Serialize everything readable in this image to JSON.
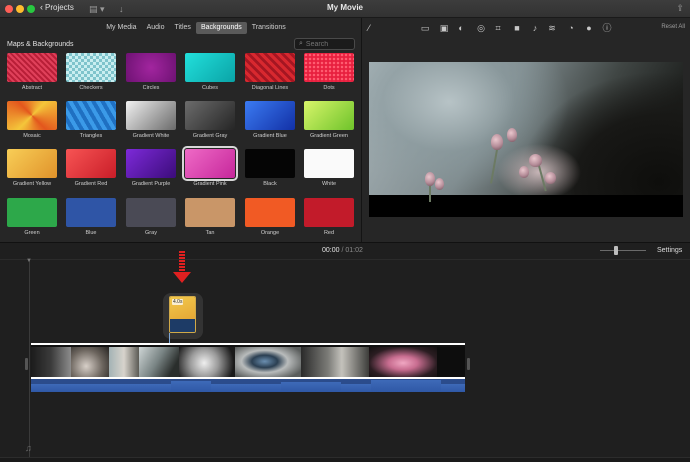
{
  "window": {
    "title": "My Movie",
    "projects_label": "Projects",
    "icons": [
      "close-icon",
      "minimize-icon",
      "zoom-icon",
      "chevron-left-icon",
      "library-list-icon",
      "import-icon",
      "share-icon"
    ]
  },
  "library": {
    "tabs": [
      {
        "label": "My Media",
        "active": false
      },
      {
        "label": "Audio",
        "active": false
      },
      {
        "label": "Titles",
        "active": false
      },
      {
        "label": "Backgrounds",
        "active": true
      },
      {
        "label": "Transitions",
        "active": false
      }
    ],
    "section_title": "Maps & Backgrounds",
    "search": {
      "placeholder": "Search",
      "value": ""
    },
    "backgrounds": [
      {
        "label": "Abstract",
        "color": "#d9344b"
      },
      {
        "label": "Checkers",
        "color": "#8fd0d4"
      },
      {
        "label": "Circles",
        "color": "#8a1b8e"
      },
      {
        "label": "Cubes",
        "color": "#14c7c4"
      },
      {
        "label": "Diagonal Lines",
        "color": "#c4202c"
      },
      {
        "label": "Dots",
        "color": "#e8203f"
      },
      {
        "label": "Mosaic",
        "color": "#f2a21c"
      },
      {
        "label": "Triangles",
        "color": "#2a85d6"
      },
      {
        "label": "Gradient White",
        "color": "#b8b8b8"
      },
      {
        "label": "Gradient Gray",
        "color": "#4f4f4f"
      },
      {
        "label": "Gradient Blue",
        "color": "#2758d9"
      },
      {
        "label": "Gradient Green",
        "color": "#b5ea4a"
      },
      {
        "label": "Gradient Yellow",
        "color": "#f2b53a"
      },
      {
        "label": "Gradient Red",
        "color": "#e83a3a"
      },
      {
        "label": "Gradient Purple",
        "color": "#5c1aa8"
      },
      {
        "label": "Gradient Pink",
        "color": "#e041b0",
        "selected": true
      },
      {
        "label": "Black",
        "color": "#050505"
      },
      {
        "label": "White",
        "color": "#fafafa"
      },
      {
        "label": "Green",
        "color": "#2da84a"
      },
      {
        "label": "Blue",
        "color": "#2f55a6"
      },
      {
        "label": "Gray",
        "color": "#4a4a55"
      },
      {
        "label": "Tan",
        "color": "#c99668"
      },
      {
        "label": "Orange",
        "color": "#f15a24"
      },
      {
        "label": "Red",
        "color": "#c21b2a"
      }
    ]
  },
  "viewer": {
    "reset_all_label": "Reset All",
    "toolbar_icons": [
      "magic-wand-icon",
      "background-icon",
      "color-balance-icon",
      "color-correction-icon",
      "speed-icon",
      "crop-icon",
      "stabilization-icon",
      "volume-icon",
      "noise-reduction-icon",
      "speed-dial-icon",
      "clip-filter-icon",
      "info-icon"
    ]
  },
  "timeline": {
    "timecode_current": "00:00",
    "timecode_separator": " / ",
    "timecode_total": "01:02",
    "settings_label": "Settings",
    "dragged_clip_duration": "4.0s"
  },
  "colors": {
    "accent_red": "#e02020",
    "audio_blue": "#2b4c8c",
    "drag_clip_top": "#f2c94c",
    "drag_clip_bottom": "#1d3b66"
  }
}
